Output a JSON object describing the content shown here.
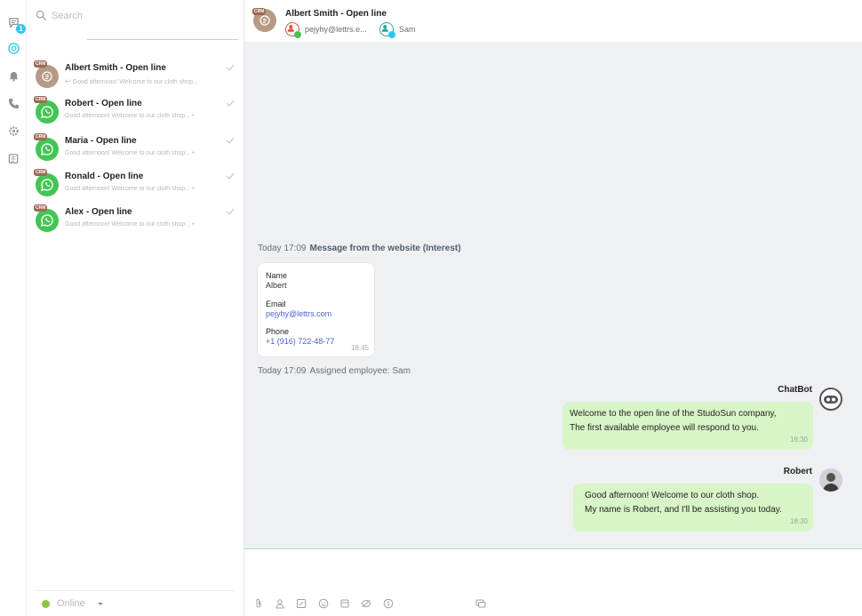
{
  "rail": {
    "chat_badge": "1"
  },
  "search": {
    "placeholder": "Search"
  },
  "chats": [
    {
      "title": "Albert Smith - Open line",
      "preview": "Good afternoon! Welcome to our cloth shop...",
      "avatar": "crm",
      "crm": "CRM"
    },
    {
      "title": "Robert - Open line",
      "preview": "Good afternoon! Welcome to our cloth shop... •",
      "avatar": "whatsapp",
      "crm": "CRM"
    },
    {
      "title": "Maria - Open line",
      "preview": "Good afternoon! Welcome to our cloth shop... •",
      "avatar": "whatsapp",
      "crm": "CRM"
    },
    {
      "title": "Ronald - Open line",
      "preview": "Good afternoon! Welcome to our cloth shop... •",
      "avatar": "whatsapp",
      "crm": "CRM"
    },
    {
      "title": "Alex - Open line",
      "preview": "Good afternoon! Welcome to our cloth shop... •",
      "avatar": "whatsapp",
      "crm": "CRM"
    }
  ],
  "status": {
    "label": "Online",
    "color": "#8dc63f"
  },
  "header": {
    "crm": "CRM",
    "title": "Albert Smith - Open line",
    "user1": "pejyhy@lettrs.e...",
    "user2": "Sam"
  },
  "conversation": {
    "sys1_time": "Today 17:09",
    "sys1_text": "Message from the website (Interest)",
    "form": {
      "name_label": "Name",
      "name_value": "Albert",
      "email_label": "Email",
      "email_value": "pejyhy@lettrs.com",
      "phone_label": "Phone",
      "phone_value": "+1 (916) 722-48-77",
      "time": "18:45"
    },
    "sys2_time": "Today 17:09",
    "sys2_text": "Assigned employee: Sam",
    "bot": {
      "sender": "ChatBot",
      "line1": "Welcome to the open line of the StudoSun company,",
      "line2": "The first available employee will respond to you.",
      "time": "18:30"
    },
    "agent": {
      "sender": "Robert",
      "line1": "Good afternoon! Welcome to our cloth shop.",
      "line2": "My name is Robert, and I'll be assisting you today.",
      "time": "18:30"
    }
  },
  "colors": {
    "whatsapp": "#43c553",
    "bubble": "#d8f5c7",
    "accent": "#2fc6f6",
    "link": "#4a62d8"
  }
}
